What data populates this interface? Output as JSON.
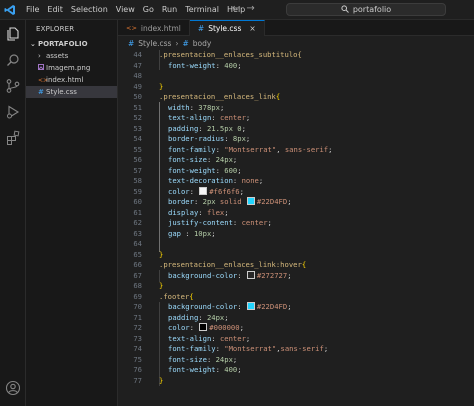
{
  "menu": [
    "File",
    "Edit",
    "Selection",
    "View",
    "Go",
    "Run",
    "Terminal",
    "Help"
  ],
  "search": {
    "text": "portafolio"
  },
  "explorer": {
    "title": "EXPLORER",
    "folder": "PORTAFOLIO",
    "items": [
      {
        "label": "assets",
        "type": "folder"
      },
      {
        "label": "Imagem.png",
        "type": "image"
      },
      {
        "label": "index.html",
        "type": "html"
      },
      {
        "label": "Style.css",
        "type": "css"
      }
    ]
  },
  "tabs": [
    {
      "label": "index.html",
      "type": "html"
    },
    {
      "label": "Style.css",
      "type": "css"
    }
  ],
  "breadcrumb": [
    "Style.css",
    "body"
  ],
  "icons": {
    "css_color": "#42a5f5",
    "html_color": "#e37933",
    "image_color": "#a074c4",
    "accent": "#0078d4"
  },
  "code": [
    {
      "n": "44",
      "indent": 0,
      "t": [
        [
          "sel",
          ".presentacion__enlaces_subtitulo{"
        ]
      ]
    },
    {
      "n": "47",
      "indent": 1,
      "t": [
        [
          "prop",
          "font-weight"
        ],
        [
          "punc",
          ": "
        ],
        [
          "num",
          "400"
        ],
        [
          "punc",
          ";"
        ]
      ]
    },
    {
      "n": "48",
      "indent": 0,
      "t": []
    },
    {
      "n": "49",
      "indent": 0,
      "t": [
        [
          "brace",
          "}"
        ]
      ]
    },
    {
      "n": "50",
      "indent": 0,
      "t": [
        [
          "sel",
          ".presentacion__enlaces_link"
        ],
        [
          "brace",
          "{"
        ]
      ]
    },
    {
      "n": "51",
      "indent": 1,
      "t": [
        [
          "prop",
          "width"
        ],
        [
          "punc",
          ": "
        ],
        [
          "num",
          "378px"
        ],
        [
          "punc",
          ";"
        ]
      ]
    },
    {
      "n": "52",
      "indent": 1,
      "t": [
        [
          "prop",
          "text-align"
        ],
        [
          "punc",
          ": "
        ],
        [
          "val",
          "center"
        ],
        [
          "punc",
          ";"
        ]
      ]
    },
    {
      "n": "53",
      "indent": 1,
      "t": [
        [
          "prop",
          "padding"
        ],
        [
          "punc",
          ": "
        ],
        [
          "num",
          "21.5px 0"
        ],
        [
          "punc",
          ";"
        ]
      ]
    },
    {
      "n": "54",
      "indent": 1,
      "t": [
        [
          "prop",
          "border-radius"
        ],
        [
          "punc",
          ": "
        ],
        [
          "num",
          "8px"
        ],
        [
          "punc",
          ";"
        ]
      ]
    },
    {
      "n": "55",
      "indent": 1,
      "t": [
        [
          "prop",
          "font-family"
        ],
        [
          "punc",
          ": "
        ],
        [
          "val",
          "\"Montserrat\""
        ],
        [
          "punc",
          ", "
        ],
        [
          "val",
          "sans-serif"
        ],
        [
          "punc",
          ";"
        ]
      ]
    },
    {
      "n": "56",
      "indent": 1,
      "t": [
        [
          "prop",
          "font-size"
        ],
        [
          "punc",
          ": "
        ],
        [
          "num",
          "24px"
        ],
        [
          "punc",
          ";"
        ]
      ]
    },
    {
      "n": "57",
      "indent": 1,
      "t": [
        [
          "prop",
          "font-weight"
        ],
        [
          "punc",
          ": "
        ],
        [
          "num",
          "600"
        ],
        [
          "punc",
          ";"
        ]
      ]
    },
    {
      "n": "58",
      "indent": 1,
      "t": [
        [
          "prop",
          "text-decoration"
        ],
        [
          "punc",
          ": "
        ],
        [
          "val",
          "none"
        ],
        [
          "punc",
          ";"
        ]
      ]
    },
    {
      "n": "59",
      "indent": 1,
      "t": [
        [
          "prop",
          "color"
        ],
        [
          "punc",
          ": "
        ],
        [
          "swatch",
          "#f6f6f6"
        ],
        [
          "val",
          "#f6f6f6"
        ],
        [
          "punc",
          ";"
        ]
      ]
    },
    {
      "n": "60",
      "indent": 1,
      "t": [
        [
          "prop",
          "border"
        ],
        [
          "punc",
          ": "
        ],
        [
          "num",
          "2px"
        ],
        [
          "val",
          " solid "
        ],
        [
          "swatch",
          "#22D4FD"
        ],
        [
          "val",
          "#22D4FD"
        ],
        [
          "punc",
          ";"
        ]
      ]
    },
    {
      "n": "61",
      "indent": 1,
      "t": [
        [
          "prop",
          "display"
        ],
        [
          "punc",
          ": "
        ],
        [
          "val",
          "flex"
        ],
        [
          "punc",
          ";"
        ]
      ]
    },
    {
      "n": "62",
      "indent": 1,
      "t": [
        [
          "prop",
          "justify-content"
        ],
        [
          "punc",
          ": "
        ],
        [
          "val",
          "center"
        ],
        [
          "punc",
          ";"
        ]
      ]
    },
    {
      "n": "63",
      "indent": 1,
      "t": [
        [
          "prop",
          "gap"
        ],
        [
          "punc",
          " : "
        ],
        [
          "num",
          "10px"
        ],
        [
          "punc",
          ";"
        ]
      ]
    },
    {
      "n": "64",
      "indent": 0,
      "t": []
    },
    {
      "n": "65",
      "indent": 0,
      "t": [
        [
          "brace",
          "}"
        ]
      ]
    },
    {
      "n": "66",
      "indent": 0,
      "t": [
        [
          "sel",
          ".presentacion__enlaces_link:hover"
        ],
        [
          "brace",
          "{"
        ]
      ]
    },
    {
      "n": "67",
      "indent": 1,
      "t": [
        [
          "prop",
          "background-color"
        ],
        [
          "punc",
          ": "
        ],
        [
          "swatch",
          "#272727"
        ],
        [
          "val",
          "#272727"
        ],
        [
          "punc",
          ";"
        ]
      ]
    },
    {
      "n": "68",
      "indent": 0,
      "t": [
        [
          "brace",
          "}"
        ]
      ]
    },
    {
      "n": "69",
      "indent": 0,
      "t": [
        [
          "sel",
          ".footer"
        ],
        [
          "brace",
          "{"
        ]
      ]
    },
    {
      "n": "70",
      "indent": 1,
      "t": [
        [
          "prop",
          "background-color"
        ],
        [
          "punc",
          ": "
        ],
        [
          "swatch",
          "#22D4FD"
        ],
        [
          "val",
          "#22D4FD"
        ],
        [
          "punc",
          ";"
        ]
      ]
    },
    {
      "n": "71",
      "indent": 1,
      "t": [
        [
          "prop",
          "padding"
        ],
        [
          "punc",
          ": "
        ],
        [
          "num",
          "24px"
        ],
        [
          "punc",
          ";"
        ]
      ]
    },
    {
      "n": "72",
      "indent": 1,
      "t": [
        [
          "prop",
          "color"
        ],
        [
          "punc",
          ": "
        ],
        [
          "swatch",
          "#000000"
        ],
        [
          "val",
          "#000000"
        ],
        [
          "punc",
          ";"
        ]
      ]
    },
    {
      "n": "73",
      "indent": 1,
      "t": [
        [
          "prop",
          "text-align"
        ],
        [
          "punc",
          ": "
        ],
        [
          "val",
          "center"
        ],
        [
          "punc",
          ";"
        ]
      ]
    },
    {
      "n": "74",
      "indent": 1,
      "t": [
        [
          "prop",
          "font-family"
        ],
        [
          "punc",
          ": "
        ],
        [
          "val",
          "\"Montserrat\""
        ],
        [
          "punc",
          ","
        ],
        [
          "val",
          "sans-serif"
        ],
        [
          "punc",
          ";"
        ]
      ]
    },
    {
      "n": "75",
      "indent": 1,
      "t": [
        [
          "prop",
          "font-size"
        ],
        [
          "punc",
          ": "
        ],
        [
          "num",
          "24px"
        ],
        [
          "punc",
          ";"
        ]
      ]
    },
    {
      "n": "76",
      "indent": 1,
      "t": [
        [
          "prop",
          "font-weight"
        ],
        [
          "punc",
          ": "
        ],
        [
          "num",
          "400"
        ],
        [
          "punc",
          ";"
        ]
      ]
    },
    {
      "n": "77",
      "indent": 0,
      "t": [
        [
          "brace",
          "}"
        ]
      ]
    }
  ]
}
